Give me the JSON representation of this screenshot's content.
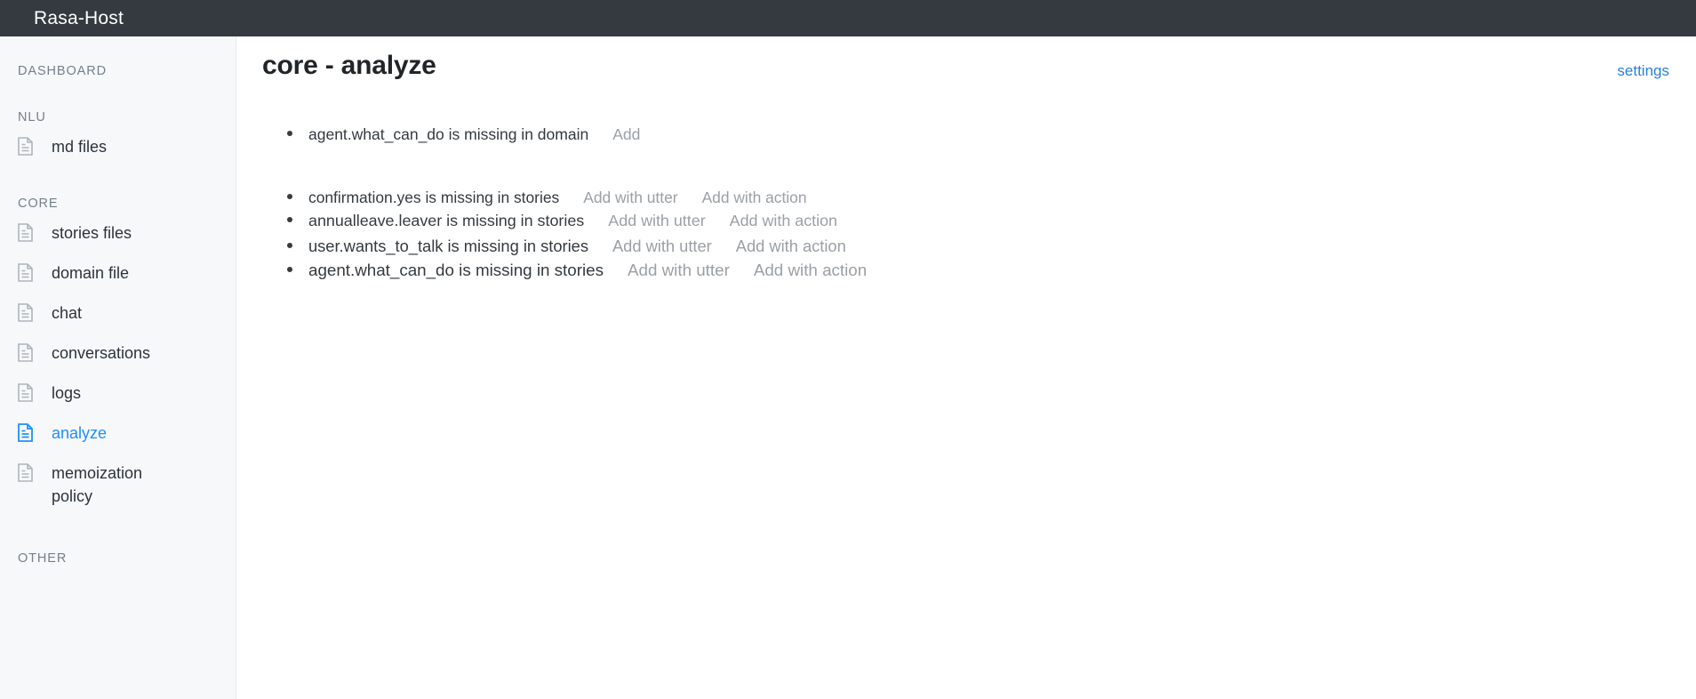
{
  "app": {
    "title": "Rasa-Host",
    "topbar_color": "#343a40",
    "accent_color": "#1f8ffa",
    "link_color": "#2a7fe0"
  },
  "sidebar": {
    "sections": [
      {
        "label": "DASHBOARD"
      },
      {
        "label": "NLU"
      },
      {
        "label": "CORE"
      },
      {
        "label": "OTHER"
      }
    ],
    "nlu_items": [
      {
        "label": "md files",
        "icon": "document-icon",
        "active": false
      }
    ],
    "core_items": [
      {
        "label": "stories files",
        "icon": "document-icon",
        "active": false
      },
      {
        "label": "domain file",
        "icon": "document-icon",
        "active": false
      },
      {
        "label": "chat",
        "icon": "document-icon",
        "active": false
      },
      {
        "label": "conversations",
        "icon": "document-icon",
        "active": false
      },
      {
        "label": "logs",
        "icon": "document-icon",
        "active": false
      },
      {
        "label": "analyze",
        "icon": "document-icon",
        "active": true
      },
      {
        "label": "memoization policy",
        "icon": "document-icon",
        "active": false
      }
    ]
  },
  "main": {
    "title": "core - analyze",
    "settings_label": "settings",
    "domain_issues": [
      {
        "text": "agent.what_can_do is missing in domain",
        "actions": [
          "Add"
        ]
      }
    ],
    "story_issues": [
      {
        "text": "confirmation.yes is missing in stories",
        "actions": [
          "Add with utter",
          "Add with action"
        ]
      },
      {
        "text": "annualleave.leaver is missing in stories",
        "actions": [
          "Add with utter",
          "Add with action"
        ]
      },
      {
        "text": "user.wants_to_talk is missing in stories",
        "actions": [
          "Add with utter",
          "Add with action"
        ]
      },
      {
        "text": "agent.what_can_do is missing in stories",
        "actions": [
          "Add with utter",
          "Add with action"
        ]
      }
    ]
  }
}
